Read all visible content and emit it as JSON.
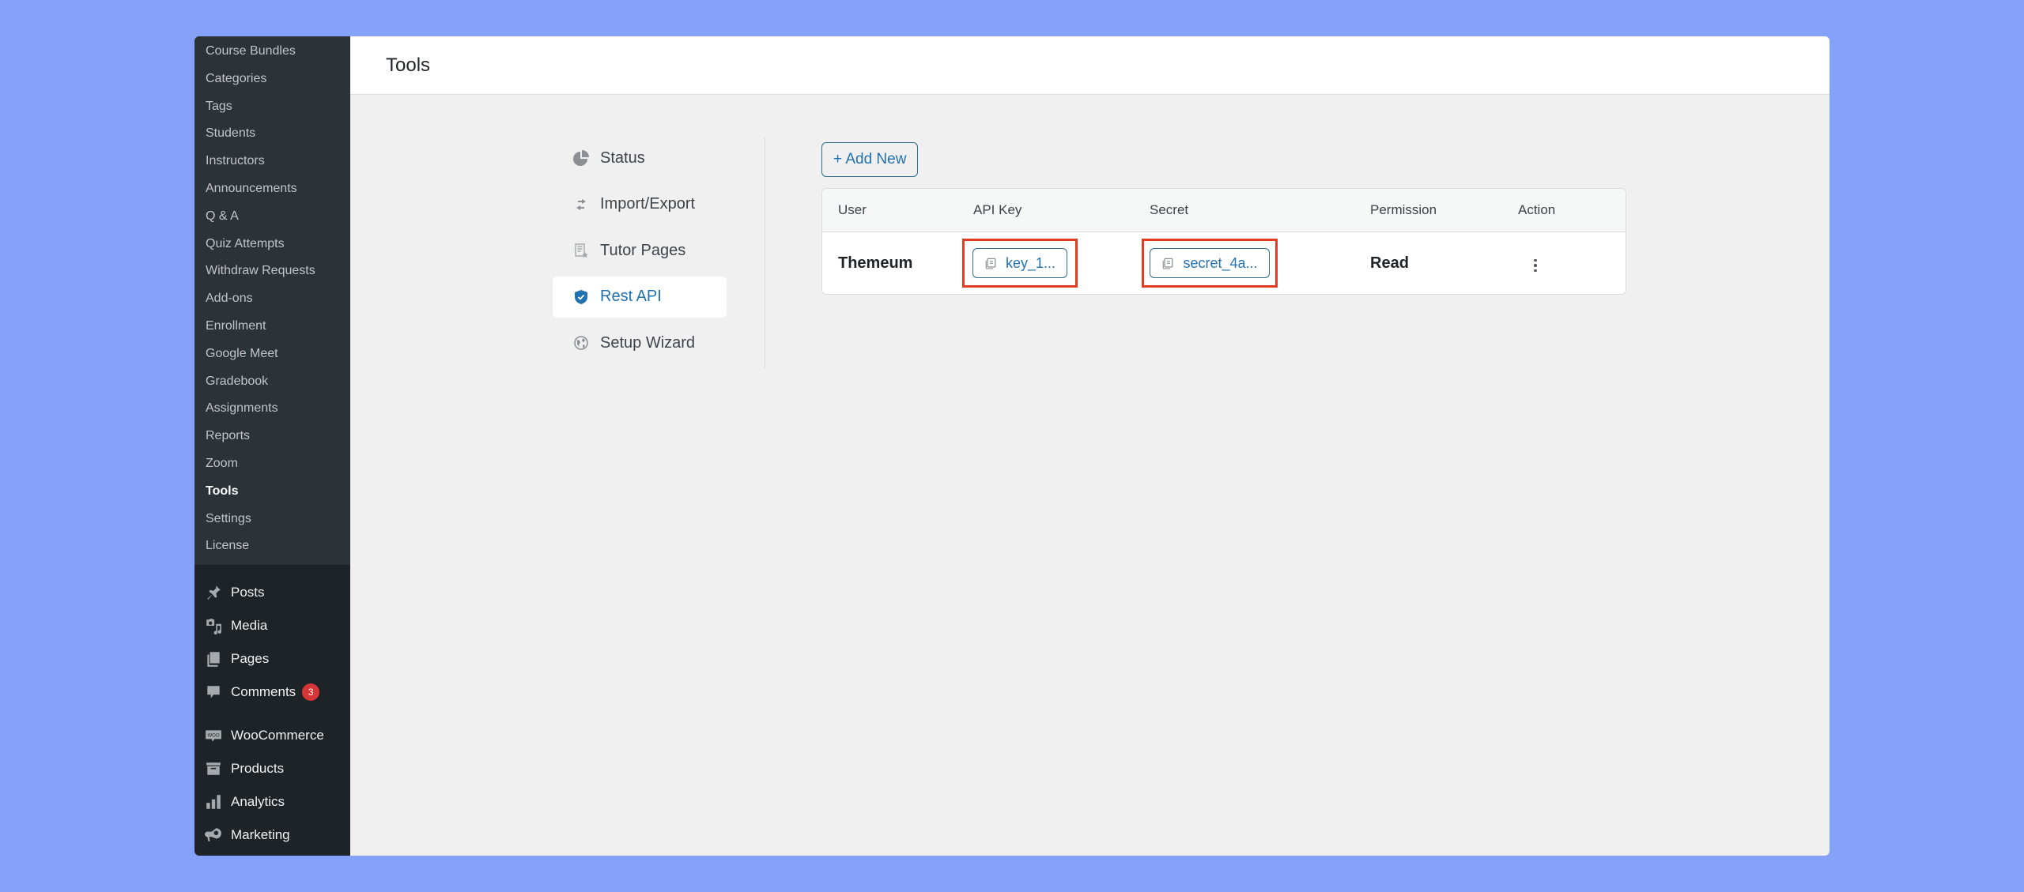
{
  "sidebar": {
    "submenu": [
      {
        "label": "Course Bundles",
        "active": false
      },
      {
        "label": "Categories",
        "active": false
      },
      {
        "label": "Tags",
        "active": false
      },
      {
        "label": "Students",
        "active": false
      },
      {
        "label": "Instructors",
        "active": false
      },
      {
        "label": "Announcements",
        "active": false
      },
      {
        "label": "Q & A",
        "active": false
      },
      {
        "label": "Quiz Attempts",
        "active": false
      },
      {
        "label": "Withdraw Requests",
        "active": false
      },
      {
        "label": "Add-ons",
        "active": false
      },
      {
        "label": "Enrollment",
        "active": false
      },
      {
        "label": "Google Meet",
        "active": false
      },
      {
        "label": "Gradebook",
        "active": false
      },
      {
        "label": "Assignments",
        "active": false
      },
      {
        "label": "Reports",
        "active": false
      },
      {
        "label": "Zoom",
        "active": false
      },
      {
        "label": "Tools",
        "active": true
      },
      {
        "label": "Settings",
        "active": false
      },
      {
        "label": "License",
        "active": false
      }
    ],
    "menu": [
      {
        "label": "Posts",
        "icon": "pushpin-icon"
      },
      {
        "label": "Media",
        "icon": "media-icon"
      },
      {
        "label": "Pages",
        "icon": "pages-icon"
      },
      {
        "label": "Comments",
        "icon": "comment-icon",
        "badge": "3"
      },
      {
        "label": "WooCommerce",
        "icon": "woocommerce-icon"
      },
      {
        "label": "Products",
        "icon": "archive-box-icon"
      },
      {
        "label": "Analytics",
        "icon": "bar-chart-icon"
      },
      {
        "label": "Marketing",
        "icon": "megaphone-icon"
      }
    ]
  },
  "header": {
    "title": "Tools"
  },
  "tools_nav": {
    "items": [
      {
        "label": "Status",
        "icon": "pie-chart-icon",
        "active": false
      },
      {
        "label": "Import/Export",
        "icon": "swap-arrows-icon",
        "active": false
      },
      {
        "label": "Tutor Pages",
        "icon": "page-star-icon",
        "active": false
      },
      {
        "label": "Rest API",
        "icon": "shield-check-icon",
        "active": true
      },
      {
        "label": "Setup Wizard",
        "icon": "globe-icon",
        "active": false
      }
    ]
  },
  "api_panel": {
    "add_new_label": "+ Add New",
    "columns": [
      "User",
      "API Key",
      "Secret",
      "Permission",
      "Action"
    ],
    "rows": [
      {
        "user": "Themeum",
        "api_key": "key_1...",
        "secret": "secret_4a...",
        "permission": "Read",
        "action_icon": "kebab-menu-icon"
      }
    ]
  },
  "colors": {
    "background": "#86a1f8",
    "accent": "#2271b1",
    "highlight_border": "#e33b1f",
    "badge": "#d63638",
    "sidebar_dark": "#1d2327",
    "submenu_bg": "#2c3338"
  }
}
